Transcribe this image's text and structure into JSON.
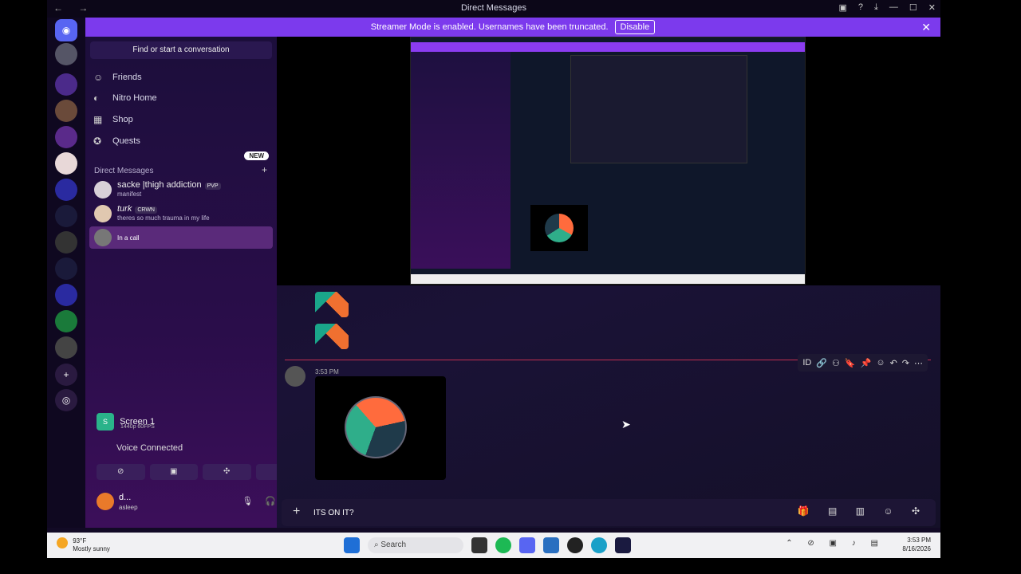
{
  "window": {
    "title": "Direct Messages",
    "nav": "← →",
    "controls": [
      "▣",
      "?",
      "⤓",
      "—",
      "☐",
      "✕"
    ]
  },
  "banner": {
    "text": "Streamer Mode is enabled. Usernames have been truncated.",
    "button": "Disable",
    "close": "✕"
  },
  "sidebar": {
    "search_placeholder": "Find or start a conversation",
    "nav": [
      {
        "label": "Friends",
        "icon": "friends-icon"
      },
      {
        "label": "Nitro Home",
        "icon": "nitro-icon"
      },
      {
        "label": "Shop",
        "icon": "shop-icon",
        "badge": "NEW"
      },
      {
        "label": "Quests",
        "icon": "quests-icon"
      }
    ],
    "dm_header": "Direct Messages",
    "dms": [
      {
        "name": "sacke |thigh addiction",
        "tag": "PVP",
        "status": "manifest"
      },
      {
        "name": "turk",
        "tag": "CRWN",
        "status": "theres so much trauma in my life"
      },
      {
        "name": "",
        "tag": "",
        "status": "In a call"
      }
    ]
  },
  "stream": {
    "name": "Screen 1",
    "quality": "1440p 60FPS",
    "voice": "Voice Connected"
  },
  "user": {
    "name": "d...",
    "status": "asleep"
  },
  "chat": {
    "time": "3:53 PM",
    "composer_value": "ITS ON IT?",
    "toolbar_icons": [
      "ID",
      "🔗",
      "⚇",
      "🔖",
      "📌",
      "☺",
      "↶",
      "↷",
      "⋯"
    ]
  },
  "taskbar": {
    "temp": "93°F",
    "weather": "Mostly sunny",
    "search": "Search",
    "time": "3:53 PM",
    "date": "8/16/2026"
  },
  "colors": {
    "accent": "#7c3aed",
    "stream_green": "#2ab38a"
  }
}
